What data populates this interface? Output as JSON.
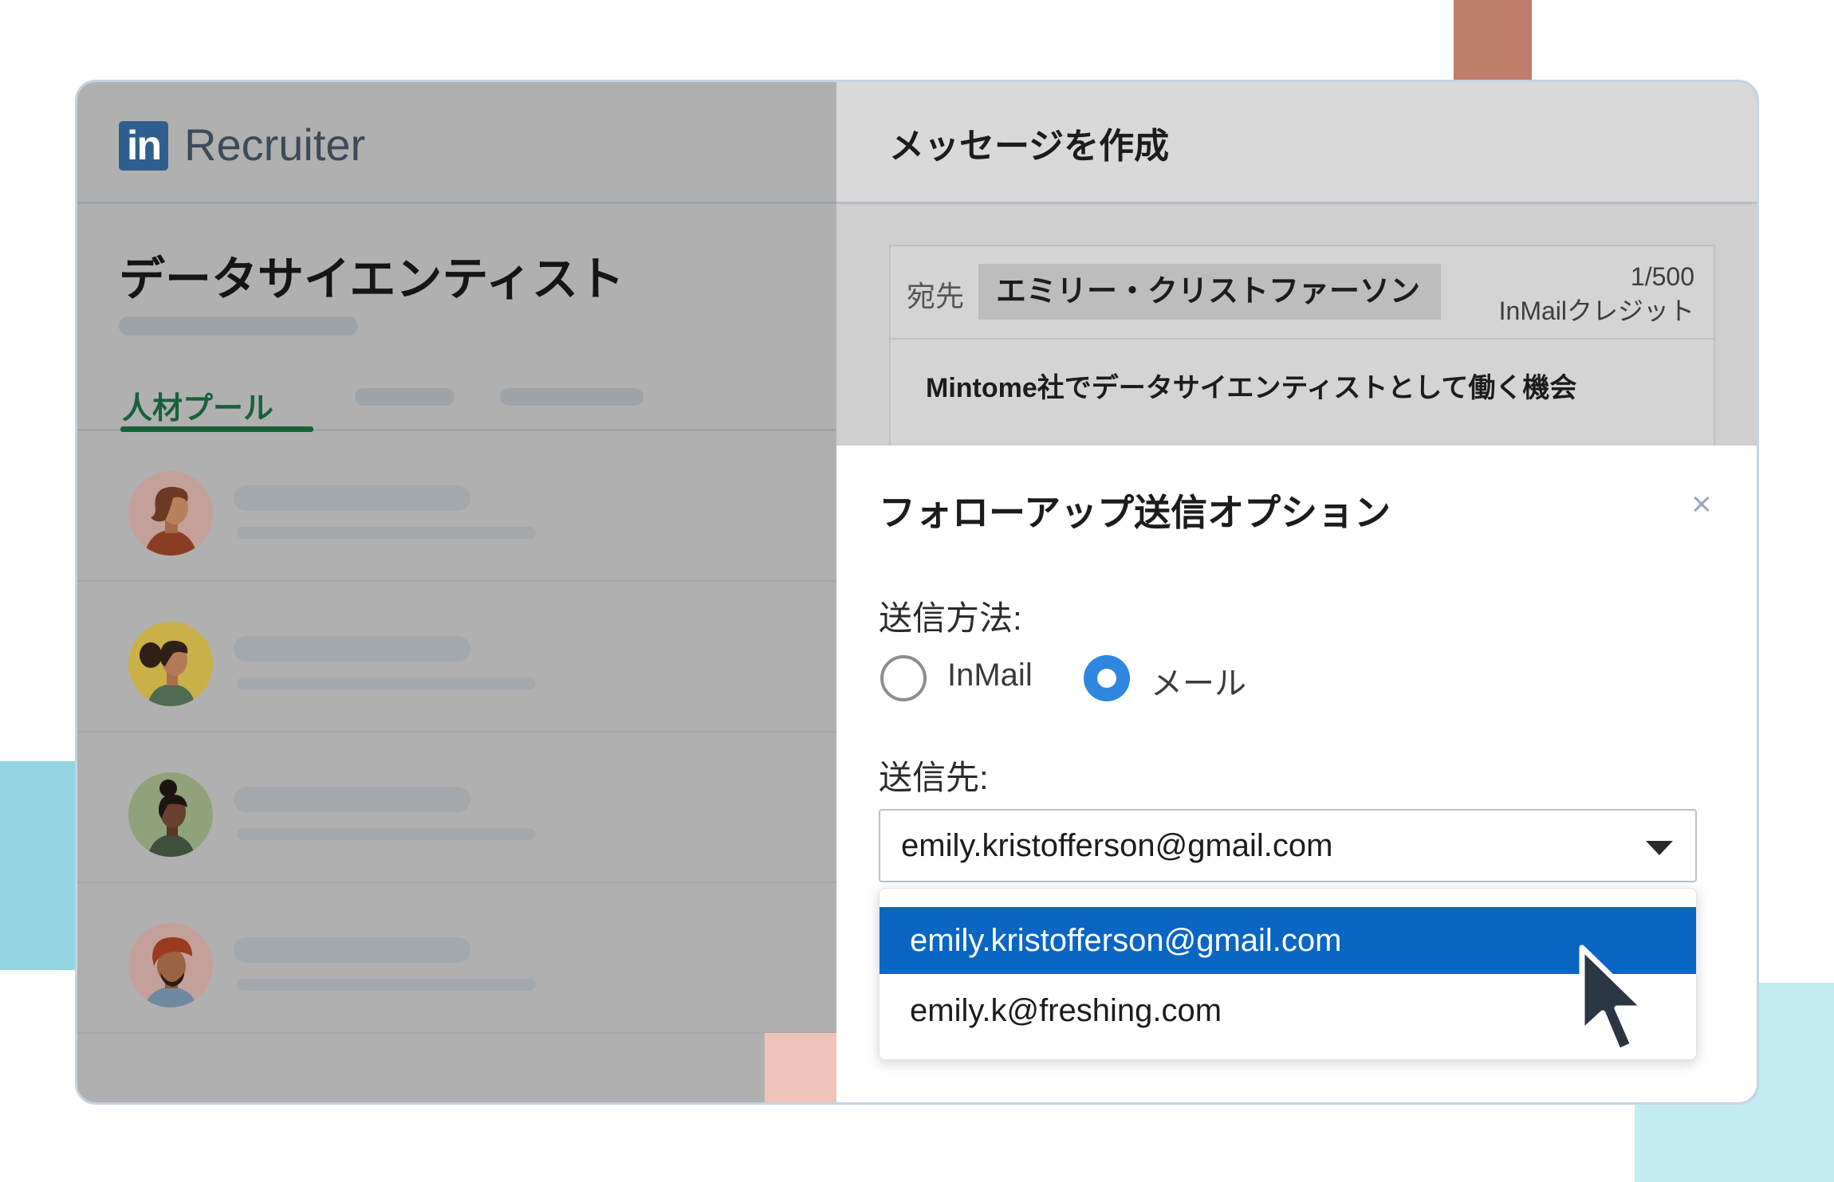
{
  "app": {
    "logo_mark": "in",
    "logo_text": "Recruiter"
  },
  "project": {
    "title": "データサイエンティスト",
    "tabs": [
      {
        "label": "人材プール",
        "active": true
      }
    ],
    "candidates": [
      {
        "avatar": "avatar-1"
      },
      {
        "avatar": "avatar-2"
      },
      {
        "avatar": "avatar-3"
      },
      {
        "avatar": "avatar-4"
      }
    ]
  },
  "compose": {
    "title": "メッセージを作成",
    "to_label": "宛先",
    "recipient": "エミリー・クリストファーソン",
    "credit_count": "1/500",
    "credit_label": "InMailクレジット",
    "subject": "Mintome社でデータサイエンティストとして働く機会"
  },
  "followup": {
    "title": "フォローアップ送信オプション",
    "close_icon": "×",
    "method_label": "送信方法:",
    "methods": [
      {
        "label": "InMail",
        "selected": false
      },
      {
        "label": "メール",
        "selected": true
      }
    ],
    "destination_label": "送信先:",
    "selected_email": "emily.kristofferson@gmail.com",
    "options": [
      {
        "label": "emily.kristofferson@gmail.com",
        "highlighted": true
      },
      {
        "label": "emily.k@freshing.com",
        "highlighted": false
      }
    ]
  },
  "colors": {
    "accent_blue": "#0a66c2",
    "radio_blue": "#2e86de",
    "tab_green": "#17613a",
    "overlay_gray": "#b0b0b0"
  }
}
